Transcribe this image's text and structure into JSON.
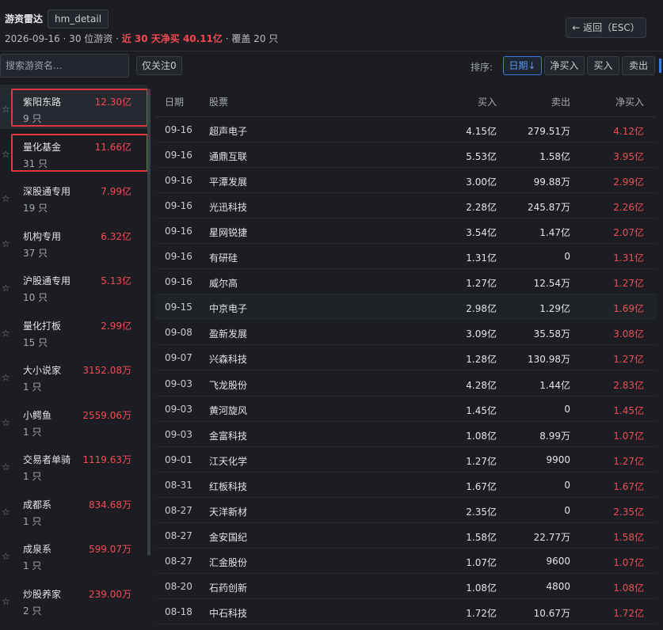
{
  "header": {
    "title": "游资雷达",
    "tag": "hm_detail",
    "subtitle_prefix": "2026-09-16 · 30 位游资 · ",
    "subtitle_highlight": "近 30 天净买 40.11亿",
    "subtitle_suffix": " · 覆盖 20 只",
    "back_label": "← 返回（ESC）"
  },
  "toolbar": {
    "search_placeholder": "搜索游资名...",
    "follow_label": "仅关注0",
    "sort_label": "排序:",
    "sort_options": [
      "日期↓",
      "净买入",
      "买入",
      "卖出"
    ],
    "active_sort": 0
  },
  "list": [
    {
      "name": "紫阳东路",
      "amount": "12.30亿",
      "count": "9 只"
    },
    {
      "name": "量化基金",
      "amount": "11.66亿",
      "count": "31 只"
    },
    {
      "name": "深股通专用",
      "amount": "7.99亿",
      "count": "19 只"
    },
    {
      "name": "机构专用",
      "amount": "6.32亿",
      "count": "37 只"
    },
    {
      "name": "沪股通专用",
      "amount": "5.13亿",
      "count": "10 只"
    },
    {
      "name": "量化打板",
      "amount": "2.99亿",
      "count": "15 只"
    },
    {
      "name": "大小说家",
      "amount": "3152.08万",
      "count": "1 只"
    },
    {
      "name": "小鳄鱼",
      "amount": "2559.06万",
      "count": "1 只"
    },
    {
      "name": "交易者单骑",
      "amount": "1119.63万",
      "count": "1 只"
    },
    {
      "name": "成都系",
      "amount": "834.68万",
      "count": "1 只"
    },
    {
      "name": "成泉系",
      "amount": "599.07万",
      "count": "1 只"
    },
    {
      "name": "炒股养家",
      "amount": "239.00万",
      "count": "2 只"
    }
  ],
  "table": {
    "headers": {
      "date": "日期",
      "stock": "股票",
      "buy": "买入",
      "sell": "卖出",
      "net": "净买入"
    },
    "rows": [
      {
        "date": "09-16",
        "stock": "超声电子",
        "buy": "4.15亿",
        "sell": "279.51万",
        "net": "4.12亿"
      },
      {
        "date": "09-16",
        "stock": "通鼎互联",
        "buy": "5.53亿",
        "sell": "1.58亿",
        "net": "3.95亿"
      },
      {
        "date": "09-16",
        "stock": "平潭发展",
        "buy": "3.00亿",
        "sell": "99.88万",
        "net": "2.99亿"
      },
      {
        "date": "09-16",
        "stock": "光迅科技",
        "buy": "2.28亿",
        "sell": "245.87万",
        "net": "2.26亿"
      },
      {
        "date": "09-16",
        "stock": "星网锐捷",
        "buy": "3.54亿",
        "sell": "1.47亿",
        "net": "2.07亿"
      },
      {
        "date": "09-16",
        "stock": "有研硅",
        "buy": "1.31亿",
        "sell": "0",
        "net": "1.31亿"
      },
      {
        "date": "09-16",
        "stock": "威尔高",
        "buy": "1.27亿",
        "sell": "12.54万",
        "net": "1.27亿"
      },
      {
        "date": "09-15",
        "stock": "中京电子",
        "buy": "2.98亿",
        "sell": "1.29亿",
        "net": "1.69亿"
      },
      {
        "date": "09-08",
        "stock": "盈新发展",
        "buy": "3.09亿",
        "sell": "35.58万",
        "net": "3.08亿"
      },
      {
        "date": "09-07",
        "stock": "兴森科技",
        "buy": "1.28亿",
        "sell": "130.98万",
        "net": "1.27亿"
      },
      {
        "date": "09-03",
        "stock": "飞龙股份",
        "buy": "4.28亿",
        "sell": "1.44亿",
        "net": "2.83亿"
      },
      {
        "date": "09-03",
        "stock": "黄河旋风",
        "buy": "1.45亿",
        "sell": "0",
        "net": "1.45亿"
      },
      {
        "date": "09-03",
        "stock": "金富科技",
        "buy": "1.08亿",
        "sell": "8.99万",
        "net": "1.07亿"
      },
      {
        "date": "09-01",
        "stock": "江天化学",
        "buy": "1.27亿",
        "sell": "9900",
        "net": "1.27亿"
      },
      {
        "date": "08-31",
        "stock": "红板科技",
        "buy": "1.67亿",
        "sell": "0",
        "net": "1.67亿"
      },
      {
        "date": "08-27",
        "stock": "天洋新材",
        "buy": "2.35亿",
        "sell": "0",
        "net": "2.35亿"
      },
      {
        "date": "08-27",
        "stock": "金安国纪",
        "buy": "1.58亿",
        "sell": "22.77万",
        "net": "1.58亿"
      },
      {
        "date": "08-27",
        "stock": "汇金股份",
        "buy": "1.07亿",
        "sell": "9600",
        "net": "1.07亿"
      },
      {
        "date": "08-20",
        "stock": "石药创新",
        "buy": "1.08亿",
        "sell": "4800",
        "net": "1.08亿"
      },
      {
        "date": "08-18",
        "stock": "中石科技",
        "buy": "1.72亿",
        "sell": "10.67万",
        "net": "1.72亿"
      }
    ]
  }
}
